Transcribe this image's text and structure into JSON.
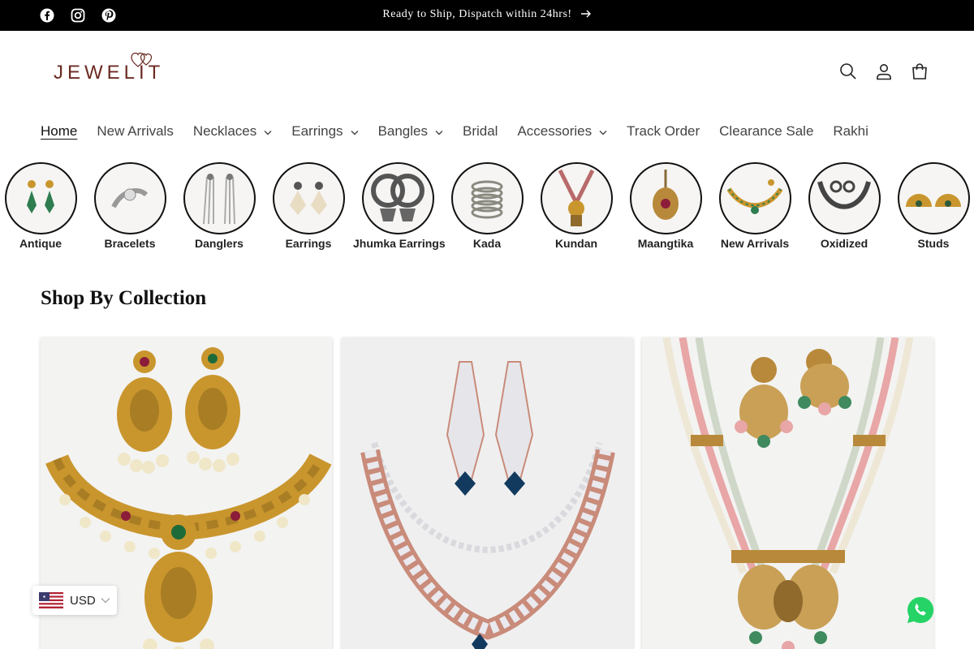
{
  "announcement": {
    "text": "Ready to Ship, Dispatch within 24hrs!"
  },
  "social": [
    "facebook-icon",
    "instagram-icon",
    "pinterest-icon"
  ],
  "brand": {
    "logo_text": "JEWELIT",
    "color": "#6b2b22"
  },
  "header_icons": [
    "search-icon",
    "account-icon",
    "cart-icon"
  ],
  "nav": {
    "items": [
      {
        "label": "Home",
        "active": true,
        "dropdown": false
      },
      {
        "label": "New Arrivals",
        "dropdown": false
      },
      {
        "label": "Necklaces",
        "dropdown": true
      },
      {
        "label": "Earrings",
        "dropdown": true
      },
      {
        "label": "Bangles",
        "dropdown": true
      },
      {
        "label": "Bridal",
        "dropdown": false
      },
      {
        "label": "Accessories",
        "dropdown": true
      },
      {
        "label": "Track Order",
        "dropdown": false
      },
      {
        "label": "Clearance Sale",
        "dropdown": false
      },
      {
        "label": "Rakhi",
        "dropdown": false
      }
    ]
  },
  "categories": [
    {
      "label": "Antique"
    },
    {
      "label": "Bracelets"
    },
    {
      "label": "Danglers"
    },
    {
      "label": "Earrings"
    },
    {
      "label": "Jhumka Earrings"
    },
    {
      "label": "Kada"
    },
    {
      "label": "Kundan"
    },
    {
      "label": "Maangtika"
    },
    {
      "label": "New Arrivals"
    },
    {
      "label": "Oxidized"
    },
    {
      "label": "Studs"
    }
  ],
  "collection": {
    "title": "Shop By Collection"
  },
  "currency": {
    "code": "USD"
  },
  "colors": {
    "topbar": "#000000",
    "gold": "#c9962e",
    "rose": "#c98b7a",
    "whatsapp": "#25d366"
  }
}
